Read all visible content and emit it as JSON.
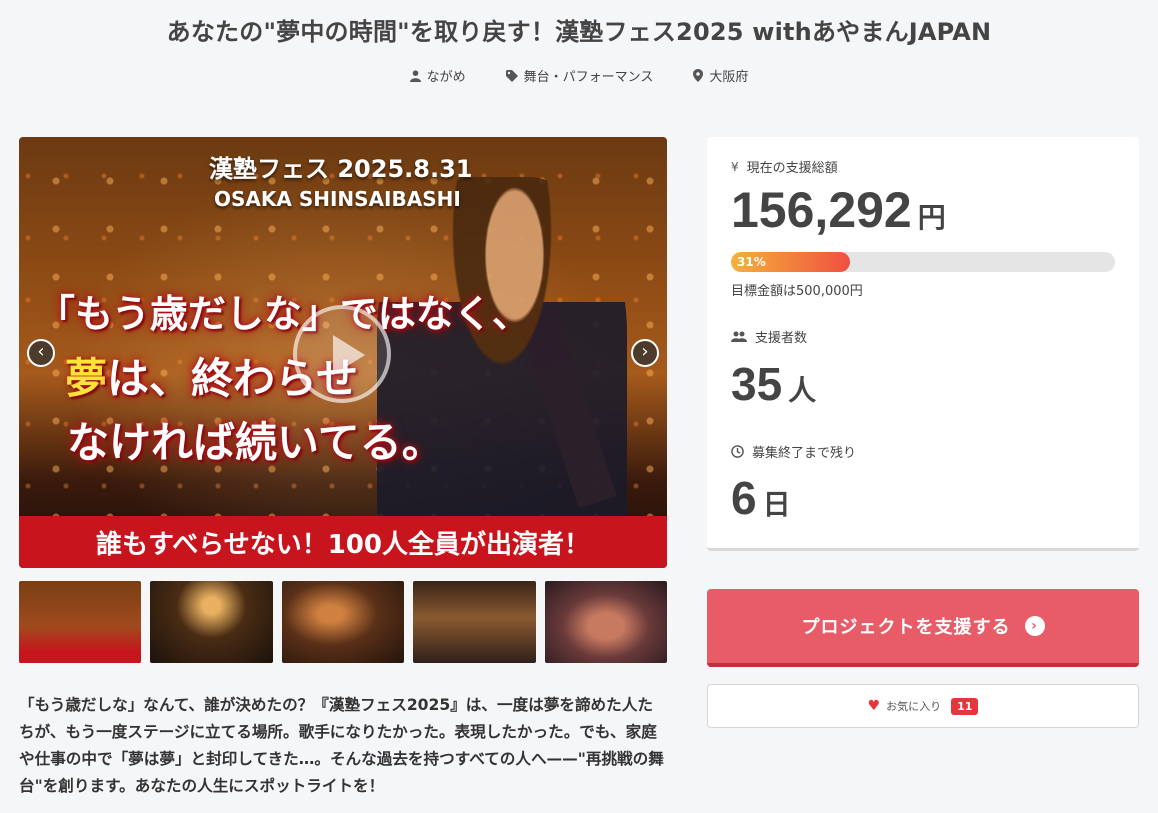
{
  "page": {
    "title": "あなたの\"夢中の時間\"を取り戻す！漢塾フェス2025 withあやまんJAPAN"
  },
  "meta": {
    "owner": "ながめ",
    "category": "舞台・パフォーマンス",
    "location": "大阪府"
  },
  "hero": {
    "headline1": "漢塾フェス 2025.8.31",
    "headline2": "OSAKA SHINSAIBASHI",
    "line1": "「もう歳だしな」ではなく、",
    "line2_yellow": "夢",
    "line2_rest": "は、終わらせ",
    "line3": "なければ続いてる。",
    "banner": "誰もすべらせない！100人全員が出演者！",
    "prev_arrow": "‹",
    "next_arrow": "›"
  },
  "description": "「もう歳だしな」なんて、誰が決めたの？『漢塾フェス2025』は、一度は夢を諦めた人たちが、もう一度ステージに立てる場所。歌手になりたかった。表現したかった。でも、家庭や仕事の中で「夢は夢」と封印してきた…。そんな過去を持つすべての人へ——\"再挑戦の舞台\"を創ります。あなたの人生にスポットライトを！",
  "stats": {
    "amount_label": "現在の支援総額",
    "amount_value": "156,292",
    "amount_unit": "円",
    "progress_percent": 31,
    "progress_label": "31%",
    "goal_text": "目標金額は500,000円",
    "backers_label": "支援者数",
    "backers_value": "35",
    "backers_unit": "人",
    "days_label": "募集終了まで残り",
    "days_value": "6",
    "days_unit": "日"
  },
  "actions": {
    "support_label": "プロジェクトを支援する",
    "support_icon": "›",
    "favorite_label": "お気に入り",
    "favorite_count": "11"
  },
  "icons": {
    "owner": "person-icon",
    "category": "tag-icon",
    "location": "map-pin-icon",
    "amount": "yen-icon",
    "backers": "people-icon",
    "days": "clock-icon",
    "favorite": "heart-icon"
  },
  "colors": {
    "accent": "#e85c68",
    "banner_red": "#c8141c",
    "favorite_red": "#e8343c"
  }
}
